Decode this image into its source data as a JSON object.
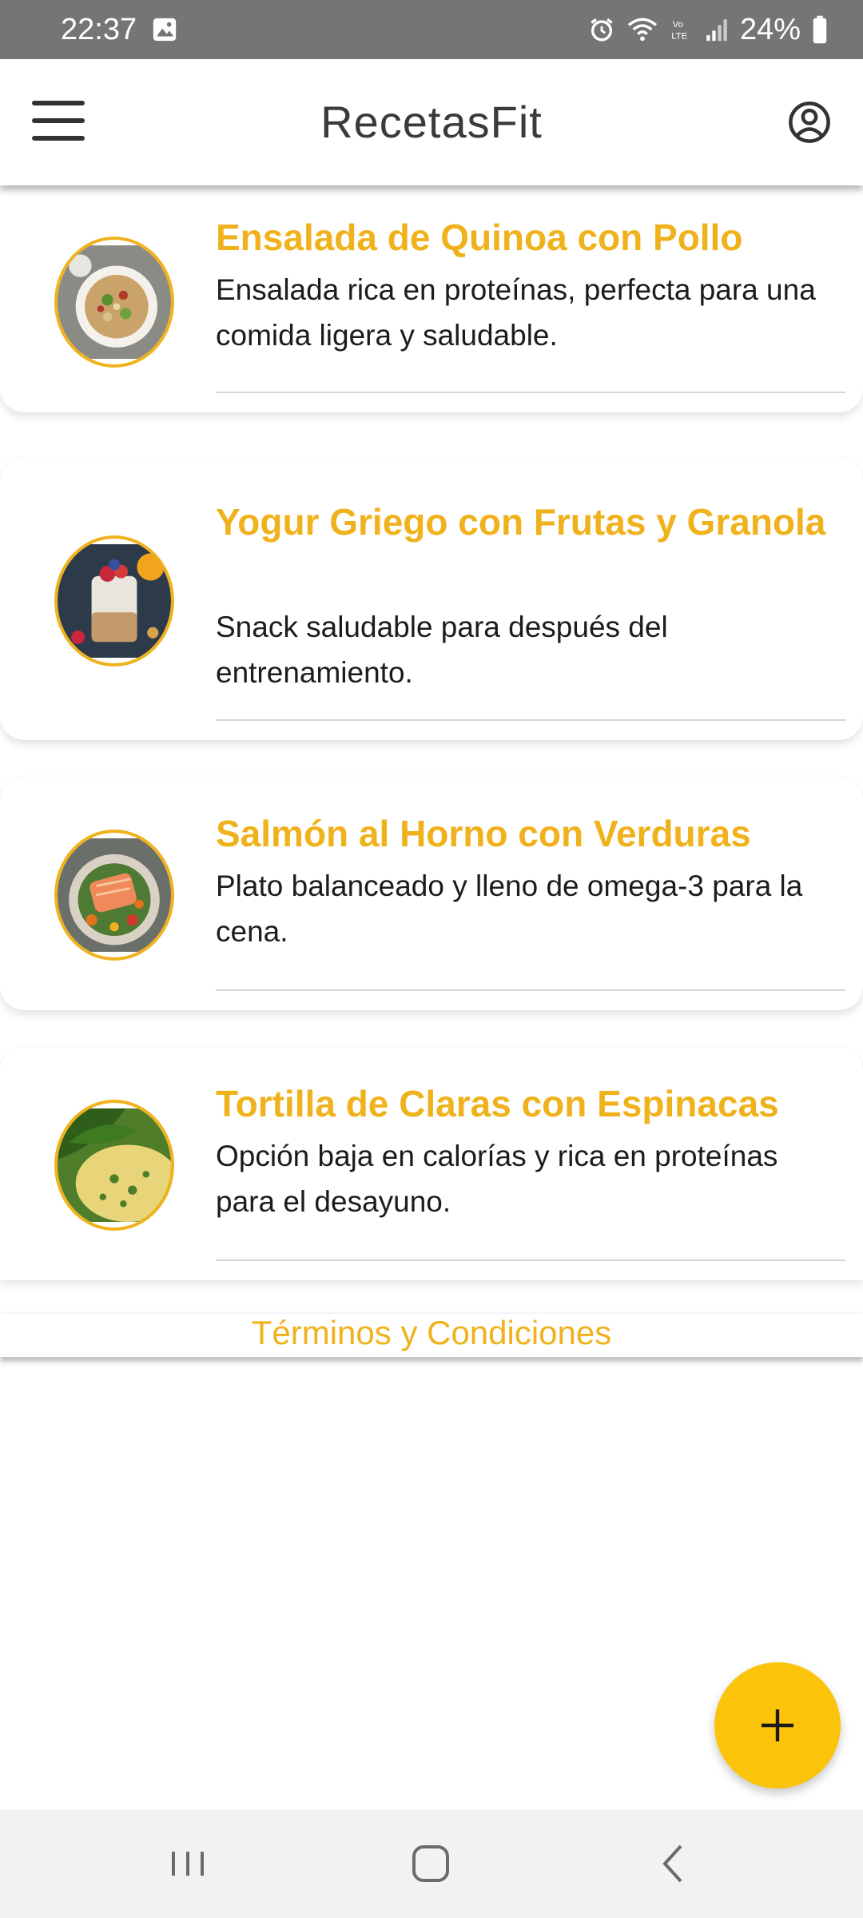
{
  "status_bar": {
    "time": "22:37",
    "battery": "24%",
    "icons": [
      "gallery-icon",
      "alarm-icon",
      "wifi-icon",
      "volte-icon",
      "signal-icon",
      "battery-icon"
    ]
  },
  "app_bar": {
    "title": "RecetasFit",
    "menu_icon": "hamburger-menu-icon",
    "account_icon": "account-circle-icon"
  },
  "recipes": [
    {
      "title": "Ensalada de Quinoa con Pollo",
      "description": "Ensalada rica en proteínas, perfecta para una comida ligera y saludable.",
      "image": "quinoa-salad-image"
    },
    {
      "title": "Yogur Griego con Frutas y Granola",
      "description": "Snack saludable para después del entrenamiento.",
      "image": "greek-yogurt-image"
    },
    {
      "title": "Salmón al Horno con Verduras",
      "description": "Plato balanceado y lleno de omega-3 para la cena.",
      "image": "baked-salmon-image"
    },
    {
      "title": "Tortilla de Claras con Espinacas",
      "description": "Opción baja en calorías y rica en proteínas para el desayuno.",
      "image": "spinach-omelette-image"
    }
  ],
  "footer": {
    "terms_label": "Términos y Condiciones"
  },
  "fab": {
    "icon": "plus-icon"
  },
  "nav_bar": {
    "icons": [
      "recent-apps-icon",
      "home-icon",
      "back-icon"
    ]
  },
  "colors": {
    "accent": "#f0b21c",
    "fab": "#fcc30b",
    "status_bar": "#757575"
  }
}
